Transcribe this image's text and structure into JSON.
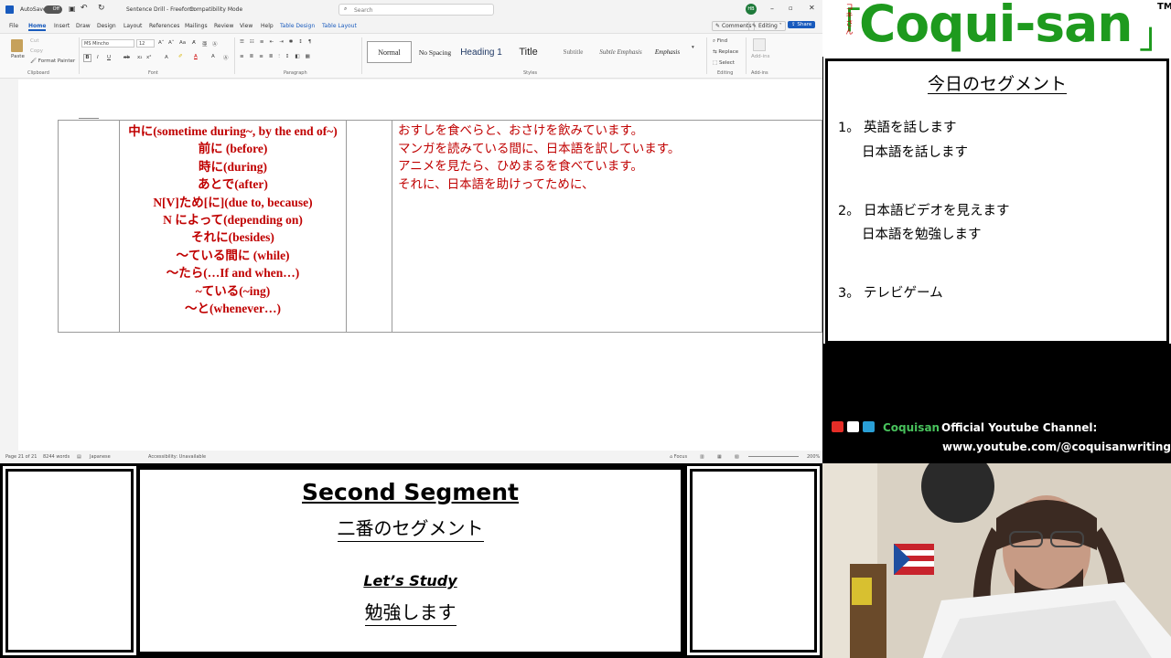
{
  "word": {
    "autosave_label": "AutoSave",
    "autosave_state": "Off",
    "doc_title": "Sentence Drill - Freeform",
    "mode": "Compatibility Mode",
    "search_placeholder": "Search",
    "avatar_initials": "HB",
    "tabs": [
      "File",
      "Home",
      "Insert",
      "Draw",
      "Design",
      "Layout",
      "References",
      "Mailings",
      "Review",
      "View",
      "Help",
      "Table Design",
      "Table Layout"
    ],
    "comments_label": "Comments",
    "editing_label": "Editing",
    "share_label": "Share",
    "font_name": "MS Mincho",
    "font_size": "12",
    "clipboard": {
      "paste": "Paste",
      "cut": "Cut",
      "copy": "Copy",
      "format_painter": "Format Painter"
    },
    "styles": [
      "Normal",
      "No Spacing",
      "Heading 1",
      "Title",
      "Subtitle",
      "Subtle Emphasis",
      "Emphasis"
    ],
    "editing_tools": [
      "Find",
      "Replace",
      "Select"
    ],
    "addins_label": "Add-ins",
    "group_labels": [
      "Clipboard",
      "Font",
      "Paragraph",
      "Styles",
      "Editing",
      "Add-ins"
    ],
    "table": {
      "grammar": [
        "中に(sometime during~, by the end of~)",
        "前に (before)",
        "時に(during)",
        "あとで(after)",
        "N[V]ため[に](due to, because)",
        "N によって(depending on)",
        "それに(besides)",
        "～ている間に (while)",
        "～たら(…If and when…)",
        "~ている(~ing)",
        "～と(whenever…)"
      ],
      "sentences": [
        "おすしを食べらと、おさけを飲みています。",
        "マンガを読みている間に、日本語を訳しています。",
        "アニメを見たら、ひめまるを食べています。",
        "それに、日本語を助けってために、"
      ]
    },
    "status": {
      "page": "Page 21 of 21",
      "words": "8244 words",
      "language": "Japanese",
      "accessibility": "Accessibility: Unavailable",
      "focus": "Focus",
      "zoom": "200%"
    }
  },
  "logo": {
    "text": "Coqui-san",
    "kana": "コキさん",
    "open_bracket": "「",
    "close_bracket": "」",
    "tm": "TM"
  },
  "segment_panel": {
    "title": "今日のセグメント",
    "items": [
      {
        "number": "1。",
        "line1": "英語を話します",
        "line2": "日本語を話します"
      },
      {
        "number": "2。",
        "line1": "日本語ビデオを見えます",
        "line2": "日本語を勉強します"
      },
      {
        "number": "3。",
        "line1": "テレビゲーム",
        "line2": ""
      }
    ]
  },
  "channel": {
    "name": "Coquisan",
    "label": "Official Youtube Channel:",
    "url": "www.youtube.com/@coquisanwriting"
  },
  "bottom": {
    "segment_en": "Second Segment",
    "segment_jp": "二番のセグメント",
    "study_en": "Let’s Study",
    "study_jp": "勉強します"
  }
}
